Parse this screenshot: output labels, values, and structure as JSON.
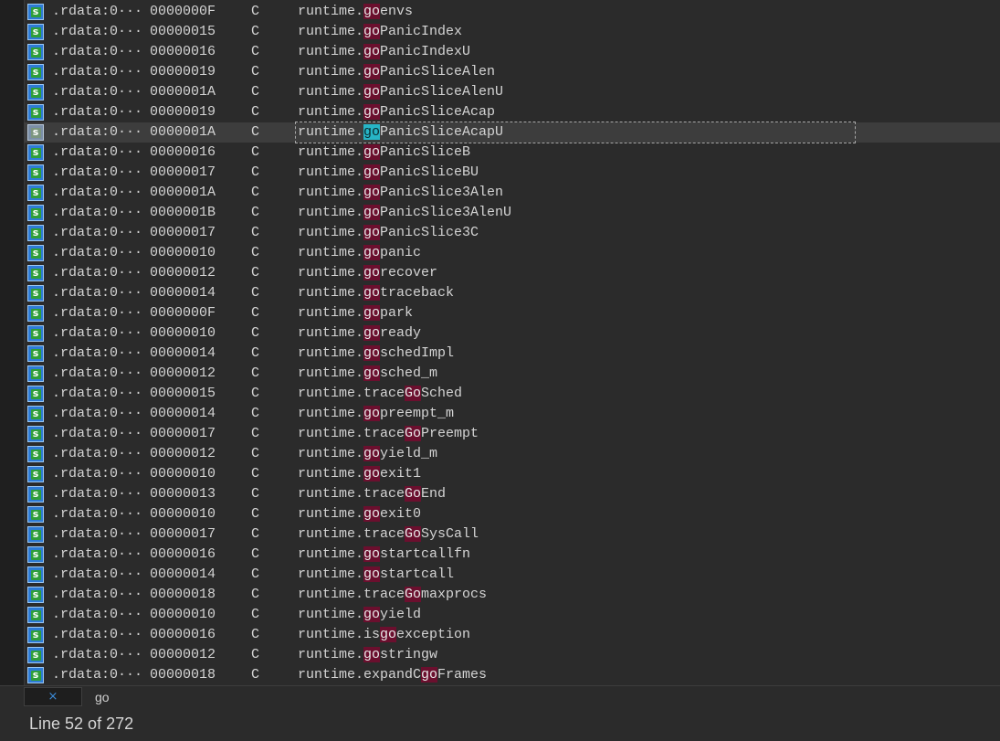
{
  "filter": {
    "text": "go",
    "close_glyph": "×",
    "close_icon": "close-icon"
  },
  "status": {
    "text": "Line 52 of 272"
  },
  "selected_row": 6,
  "colors": {
    "match": "#6b0f2e",
    "current_match": "#27b5c6",
    "selected_row": "#3d3d3d"
  },
  "rows": [
    {
      "seg": ".rdata:0···",
      "len": "0000000F",
      "type": "C",
      "pre": "runtime.",
      "match": "go",
      "post": "envs"
    },
    {
      "seg": ".rdata:0···",
      "len": "00000015",
      "type": "C",
      "pre": "runtime.",
      "match": "go",
      "post": "PanicIndex"
    },
    {
      "seg": ".rdata:0···",
      "len": "00000016",
      "type": "C",
      "pre": "runtime.",
      "match": "go",
      "post": "PanicIndexU"
    },
    {
      "seg": ".rdata:0···",
      "len": "00000019",
      "type": "C",
      "pre": "runtime.",
      "match": "go",
      "post": "PanicSliceAlen"
    },
    {
      "seg": ".rdata:0···",
      "len": "0000001A",
      "type": "C",
      "pre": "runtime.",
      "match": "go",
      "post": "PanicSliceAlenU"
    },
    {
      "seg": ".rdata:0···",
      "len": "00000019",
      "type": "C",
      "pre": "runtime.",
      "match": "go",
      "post": "PanicSliceAcap"
    },
    {
      "seg": ".rdata:0···",
      "len": "0000001A",
      "type": "C",
      "pre": "runtime.",
      "match": "go",
      "post": "PanicSliceAcapU"
    },
    {
      "seg": ".rdata:0···",
      "len": "00000016",
      "type": "C",
      "pre": "runtime.",
      "match": "go",
      "post": "PanicSliceB"
    },
    {
      "seg": ".rdata:0···",
      "len": "00000017",
      "type": "C",
      "pre": "runtime.",
      "match": "go",
      "post": "PanicSliceBU"
    },
    {
      "seg": ".rdata:0···",
      "len": "0000001A",
      "type": "C",
      "pre": "runtime.",
      "match": "go",
      "post": "PanicSlice3Alen"
    },
    {
      "seg": ".rdata:0···",
      "len": "0000001B",
      "type": "C",
      "pre": "runtime.",
      "match": "go",
      "post": "PanicSlice3AlenU"
    },
    {
      "seg": ".rdata:0···",
      "len": "00000017",
      "type": "C",
      "pre": "runtime.",
      "match": "go",
      "post": "PanicSlice3C"
    },
    {
      "seg": ".rdata:0···",
      "len": "00000010",
      "type": "C",
      "pre": "runtime.",
      "match": "go",
      "post": "panic"
    },
    {
      "seg": ".rdata:0···",
      "len": "00000012",
      "type": "C",
      "pre": "runtime.",
      "match": "go",
      "post": "recover"
    },
    {
      "seg": ".rdata:0···",
      "len": "00000014",
      "type": "C",
      "pre": "runtime.",
      "match": "go",
      "post": "traceback"
    },
    {
      "seg": ".rdata:0···",
      "len": "0000000F",
      "type": "C",
      "pre": "runtime.",
      "match": "go",
      "post": "park"
    },
    {
      "seg": ".rdata:0···",
      "len": "00000010",
      "type": "C",
      "pre": "runtime.",
      "match": "go",
      "post": "ready"
    },
    {
      "seg": ".rdata:0···",
      "len": "00000014",
      "type": "C",
      "pre": "runtime.",
      "match": "go",
      "post": "schedImpl"
    },
    {
      "seg": ".rdata:0···",
      "len": "00000012",
      "type": "C",
      "pre": "runtime.",
      "match": "go",
      "post": "sched_m"
    },
    {
      "seg": ".rdata:0···",
      "len": "00000015",
      "type": "C",
      "pre": "runtime.trace",
      "match": "Go",
      "post": "Sched"
    },
    {
      "seg": ".rdata:0···",
      "len": "00000014",
      "type": "C",
      "pre": "runtime.",
      "match": "go",
      "post": "preempt_m"
    },
    {
      "seg": ".rdata:0···",
      "len": "00000017",
      "type": "C",
      "pre": "runtime.trace",
      "match": "Go",
      "post": "Preempt"
    },
    {
      "seg": ".rdata:0···",
      "len": "00000012",
      "type": "C",
      "pre": "runtime.",
      "match": "go",
      "post": "yield_m"
    },
    {
      "seg": ".rdata:0···",
      "len": "00000010",
      "type": "C",
      "pre": "runtime.",
      "match": "go",
      "post": "exit1"
    },
    {
      "seg": ".rdata:0···",
      "len": "00000013",
      "type": "C",
      "pre": "runtime.trace",
      "match": "Go",
      "post": "End"
    },
    {
      "seg": ".rdata:0···",
      "len": "00000010",
      "type": "C",
      "pre": "runtime.",
      "match": "go",
      "post": "exit0"
    },
    {
      "seg": ".rdata:0···",
      "len": "00000017",
      "type": "C",
      "pre": "runtime.trace",
      "match": "Go",
      "post": "SysCall"
    },
    {
      "seg": ".rdata:0···",
      "len": "00000016",
      "type": "C",
      "pre": "runtime.",
      "match": "go",
      "post": "startcallfn"
    },
    {
      "seg": ".rdata:0···",
      "len": "00000014",
      "type": "C",
      "pre": "runtime.",
      "match": "go",
      "post": "startcall"
    },
    {
      "seg": ".rdata:0···",
      "len": "00000018",
      "type": "C",
      "pre": "runtime.trace",
      "match": "Go",
      "post": "maxprocs"
    },
    {
      "seg": ".rdata:0···",
      "len": "00000010",
      "type": "C",
      "pre": "runtime.",
      "match": "go",
      "post": "yield"
    },
    {
      "seg": ".rdata:0···",
      "len": "00000016",
      "type": "C",
      "pre": "runtime.is",
      "match": "go",
      "post": "exception"
    },
    {
      "seg": ".rdata:0···",
      "len": "00000012",
      "type": "C",
      "pre": "runtime.",
      "match": "go",
      "post": "stringw"
    },
    {
      "seg": ".rdata:0···",
      "len": "00000018",
      "type": "C",
      "pre": "runtime.expandC",
      "match": "go",
      "post": "Frames"
    }
  ]
}
